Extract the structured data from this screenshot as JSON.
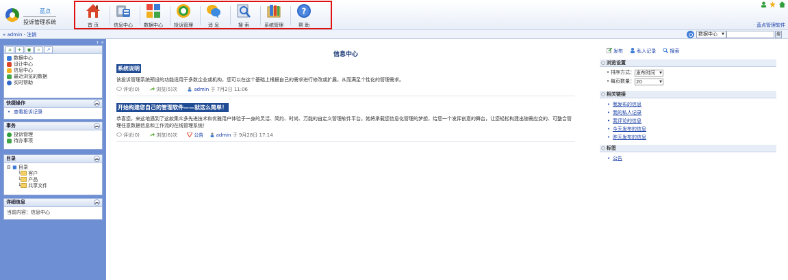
{
  "header": {
    "brand": "蓝点",
    "app_name": "投诉管理系统",
    "brand_link": "· 蓝点管理软件"
  },
  "topnav": [
    {
      "label": "首 页",
      "icon": "home-icon"
    },
    {
      "label": "信息中心",
      "icon": "info-center-icon"
    },
    {
      "label": "数据中心",
      "icon": "data-center-icon"
    },
    {
      "label": "投诉管理",
      "icon": "complaint-icon"
    },
    {
      "label": "消 息",
      "icon": "message-icon"
    },
    {
      "label": "搜 索",
      "icon": "search-icon"
    },
    {
      "label": "系统管理",
      "icon": "system-icon"
    },
    {
      "label": "帮 助",
      "icon": "help-icon"
    }
  ],
  "userbar": {
    "text": "« admin · 注销"
  },
  "search": {
    "scope": "数据中心",
    "button": "搜"
  },
  "sidebar": {
    "main_items": [
      "数据中心",
      "设计中心",
      "信息中心",
      "最近浏览的数据",
      "实时帮助"
    ],
    "quick": {
      "title": "快捷操作",
      "items": [
        "查看投诉记录"
      ]
    },
    "tasks": {
      "title": "事务",
      "items": [
        "投诉管理",
        "待办事项"
      ]
    },
    "dir": {
      "title": "目录",
      "root": "目录",
      "children": [
        "客户",
        "产品",
        "共享文件"
      ]
    },
    "detail": {
      "title": "详细信息",
      "current": "当前内容：信息中心"
    }
  },
  "main": {
    "title": "信息中心",
    "posts": [
      {
        "title": "系统说明",
        "body": "该投诉管理系统预设的功能适用于多数企业或机构，您可以在这个基础上根据自己的需求进行修改或扩展，从而满足个性化的管理需求。",
        "comments": "评论(0)",
        "views": "浏览(5)次",
        "tag": "",
        "author": "admin",
        "date": "于 7月2日 11:06"
      },
      {
        "title": "开始构建您自己的管理软件——就这么简单！",
        "body": "恭喜您，来这地遇到了这款集众多先进技术和优雅用户体验于一身的灵活、简约、时尚、万能的自定义管理软件平台。她将承载您信息化管理的梦想，给您一个发挥创意的舞台，让您轻松构建出随需应变的、可整合管理任意数据信息和工作流的在线管理系统！",
        "comments": "评论(0)",
        "views": "浏览(6)次",
        "tag": "公告",
        "author": "admin",
        "date": "于 9月28日 17:14"
      }
    ]
  },
  "right": {
    "links": [
      "发布",
      "私人记录",
      "搜索"
    ],
    "browse": {
      "title": "浏览设置",
      "sort_label": "排序方式：",
      "sort_value": "发布时间",
      "page_label": "每页数量：",
      "page_value": "20"
    },
    "related": {
      "title": "相关链接",
      "items": [
        "我发布的信息",
        "我的私人记录",
        "我评论的信息",
        "今天发布的信息",
        "昨天发布的信息"
      ]
    },
    "tags": {
      "title": "标签",
      "items": [
        "公告"
      ]
    }
  }
}
